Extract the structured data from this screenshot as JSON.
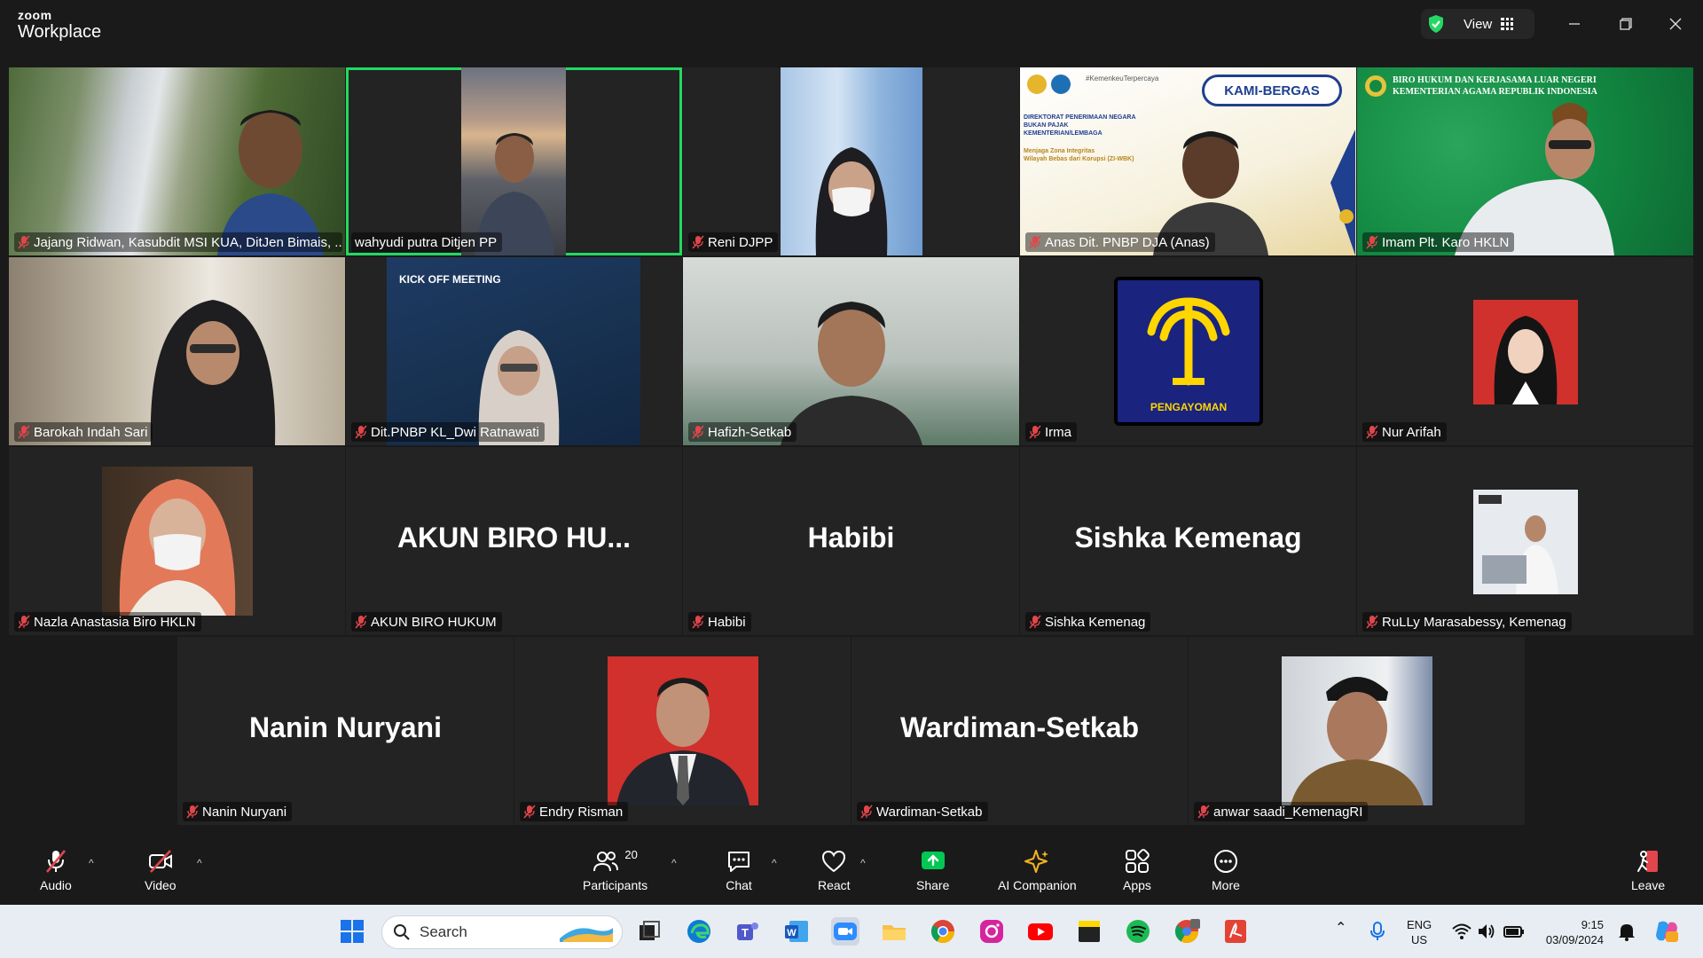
{
  "app": {
    "brand_small": "zoom",
    "brand_big": "Workplace",
    "view_label": "View"
  },
  "colors": {
    "accent_green": "#23d962",
    "muted_red": "#e0464b",
    "share_green": "#00c853",
    "bg": "#1a1a1a"
  },
  "participants": [
    {
      "name": "Jajang Ridwan, Kasubdit MSI KUA, DitJen Bimais, ..."
    },
    {
      "name": "wahyudi putra Ditjen PP"
    },
    {
      "name": "Reni DJPP"
    },
    {
      "name": "Anas Dit. PNBP DJA (Anas)"
    },
    {
      "name": "Imam Plt. Karo HKLN"
    },
    {
      "name": "Barokah Indah Sari"
    },
    {
      "name": "Dit.PNBP KL_Dwi Ratnawati"
    },
    {
      "name": "Hafizh-Setkab"
    },
    {
      "name": "Irma"
    },
    {
      "name": "Nur Arifah"
    },
    {
      "name": "Nazla Anastasia Biro HKLN"
    },
    {
      "name": "AKUN BIRO HUKUM",
      "display": "AKUN BIRO HU..."
    },
    {
      "name": "Habibi",
      "display": "Habibi"
    },
    {
      "name": "Sishka Kemenag",
      "display": "Sishka Kemenag"
    },
    {
      "name": "RuLLy Marasabessy, Kemenag"
    },
    {
      "name": "Nanin Nuryani",
      "display": "Nanin Nuryani"
    },
    {
      "name": "Endry Risman"
    },
    {
      "name": "Wardiman-Setkab",
      "display": "Wardiman-Setkab"
    },
    {
      "name": "anwar saadi_KemenagRI"
    }
  ],
  "tile_texts": {
    "banner_tag": "#KemenkeuTerpercaya",
    "kami_bergas": "KAMI-BERGAS",
    "dit_line1": "DIREKTORAT PENERIMAAN NEGARA",
    "dit_line2": "BUKAN PAJAK",
    "dit_line3": "KEMENTERIAN/LEMBAGA",
    "zi_line1": "Menjaga Zona Integritas",
    "zi_line2": "Wilayah Bebas dari Korupsi (ZI-WBK)",
    "biro_line1": "BIRO HUKUM DAN KERJASAMA LUAR NEGERI",
    "biro_line2": "KEMENTERIAN AGAMA REPUBLIK INDONESIA",
    "kickoff_line1": "KICK OFF MEETING",
    "pengayoman": "PENGAYOMAN"
  },
  "toolbar": {
    "audio": "Audio",
    "video": "Video",
    "participants": "Participants",
    "participants_count": "20",
    "chat": "Chat",
    "react": "React",
    "share": "Share",
    "ai": "AI Companion",
    "apps": "Apps",
    "more": "More",
    "leave": "Leave"
  },
  "taskbar": {
    "search_label": "Search",
    "lang_line1": "ENG",
    "lang_line2": "US",
    "time": "9:15",
    "date": "03/09/2024"
  }
}
